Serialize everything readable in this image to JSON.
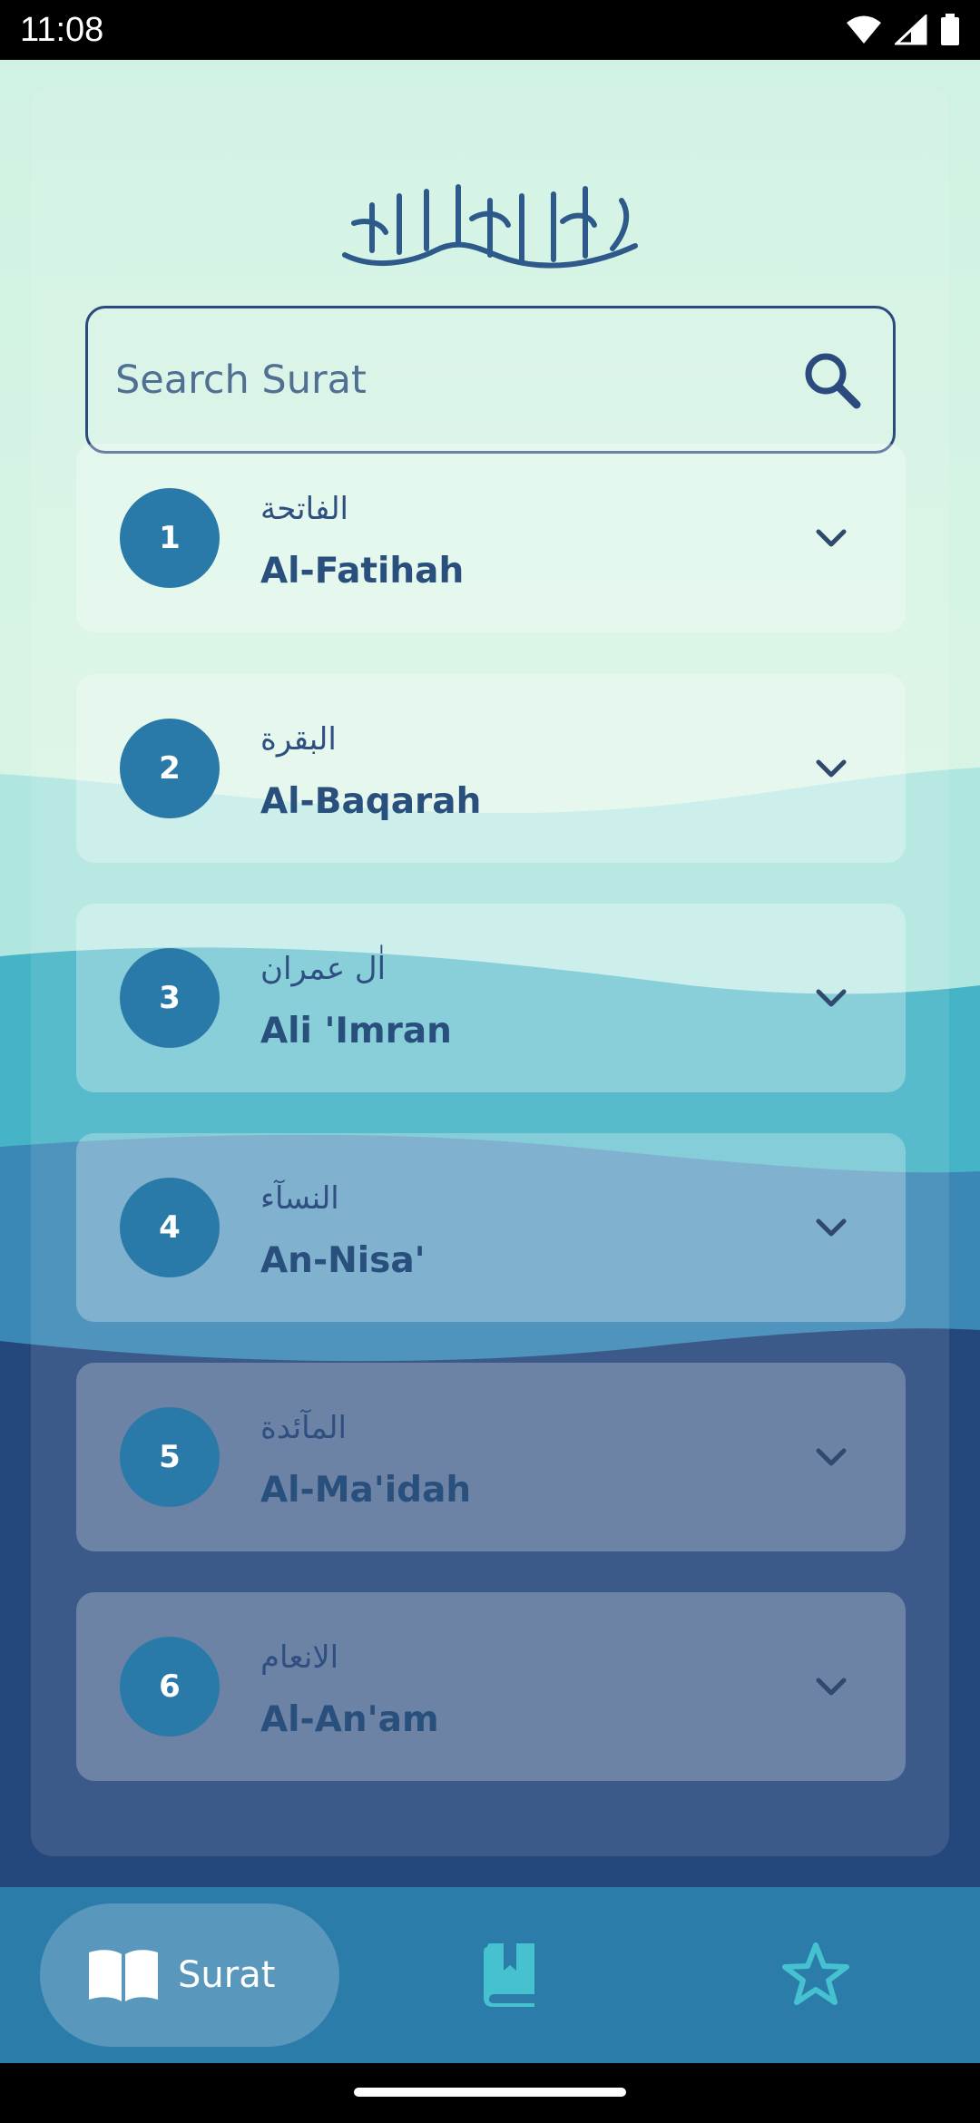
{
  "status_bar": {
    "time": "11:08"
  },
  "header": {},
  "search": {
    "placeholder": "Search Surat"
  },
  "surahs": [
    {
      "number": "1",
      "arabic": "الفاتحة",
      "latin": "Al-Fatihah"
    },
    {
      "number": "2",
      "arabic": "البقرة",
      "latin": "Al-Baqarah"
    },
    {
      "number": "3",
      "arabic": "اٰل عمران",
      "latin": "Ali 'Imran"
    },
    {
      "number": "4",
      "arabic": "النسآء",
      "latin": "An-Nisa'"
    },
    {
      "number": "5",
      "arabic": "المآئدة",
      "latin": "Al-Ma'idah"
    },
    {
      "number": "6",
      "arabic": "الانعام",
      "latin": "Al-An'am"
    }
  ],
  "nav": {
    "items": [
      {
        "label": "Surat",
        "icon": "book-open-icon",
        "active": true
      },
      {
        "label": "",
        "icon": "bookmark-book-icon",
        "active": false
      },
      {
        "label": "",
        "icon": "star-icon",
        "active": false
      }
    ]
  },
  "colors": {
    "accent": "#2a7aa9",
    "text_dark": "#294f7d",
    "nav_bg": "#2b7ca9"
  }
}
